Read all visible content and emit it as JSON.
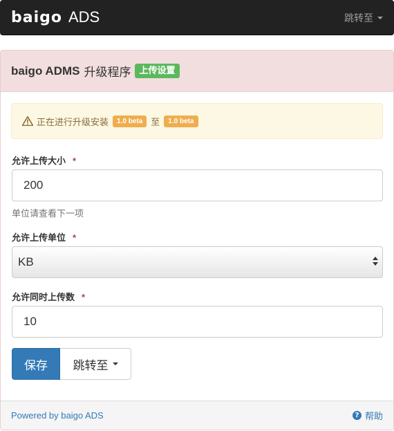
{
  "navbar": {
    "logo": "baigo",
    "brand_suffix": "ADS",
    "jump_label": "跳转至"
  },
  "panel": {
    "title": "baigo ADMS",
    "title_suffix": "升级程序",
    "badge": "上传设置"
  },
  "alert": {
    "icon": "warning-icon",
    "text_prefix": "正在进行升级安装",
    "from_version": "1.0 beta",
    "connector": "至",
    "to_version": "1.0 beta"
  },
  "form": {
    "upload_size": {
      "label": "允许上传大小",
      "required": "*",
      "value": "200",
      "help": "单位请查看下一项"
    },
    "upload_unit": {
      "label": "允许上传单位",
      "required": "*",
      "selected": "KB"
    },
    "upload_count": {
      "label": "允许同时上传数",
      "required": "*",
      "value": "10"
    }
  },
  "actions": {
    "save_label": "保存",
    "jump_label": "跳转至"
  },
  "footer": {
    "powered_by": "Powered by baigo ADS",
    "help_icon": "question-circle-icon",
    "help_label": "帮助"
  },
  "colors": {
    "navbar_bg": "#222222",
    "panel_heading_bg": "#f2dede",
    "badge_success": "#5cb85c",
    "badge_warning": "#f0ad4e",
    "alert_bg": "#fcf8e3",
    "primary": "#337ab7"
  }
}
